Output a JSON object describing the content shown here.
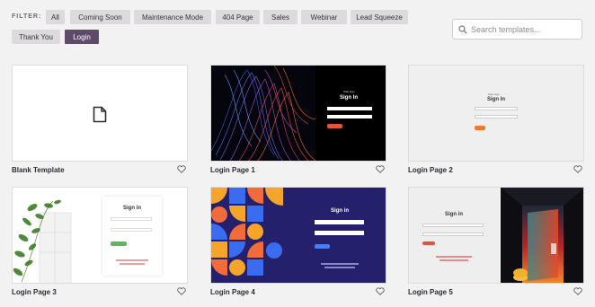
{
  "filter": {
    "label": "FILTER:",
    "chips": [
      {
        "label": "All",
        "active": false
      },
      {
        "label": "Coming Soon",
        "active": false
      },
      {
        "label": "Maintenance Mode",
        "active": false
      },
      {
        "label": "404 Page",
        "active": false
      },
      {
        "label": "Sales",
        "active": false
      },
      {
        "label": "Webinar",
        "active": false
      },
      {
        "label": "Lead Squeeze",
        "active": false
      },
      {
        "label": "Thank You",
        "active": false
      },
      {
        "label": "Login",
        "active": true
      }
    ]
  },
  "search": {
    "placeholder": "Search templates...",
    "icon": "search-icon"
  },
  "templates": [
    {
      "name": "Blank Template",
      "icon": "document-icon"
    },
    {
      "name": "Login Page 1",
      "preview": {
        "heading": "Sign In",
        "kicker": "Stop logo"
      }
    },
    {
      "name": "Login Page 2",
      "preview": {
        "heading": "Sign In",
        "kicker": "Stop logo"
      }
    },
    {
      "name": "Login Page 3",
      "preview": {
        "heading": "Sign in"
      }
    },
    {
      "name": "Login Page 4",
      "preview": {
        "heading": "Sign in"
      }
    },
    {
      "name": "Login Page 5",
      "preview": {
        "heading": "Sign in"
      }
    }
  ],
  "colors": {
    "active_chip": "#5f4a69",
    "chip": "#dcdadd",
    "accent_button": "#e5523e",
    "navy": "#24206b"
  }
}
